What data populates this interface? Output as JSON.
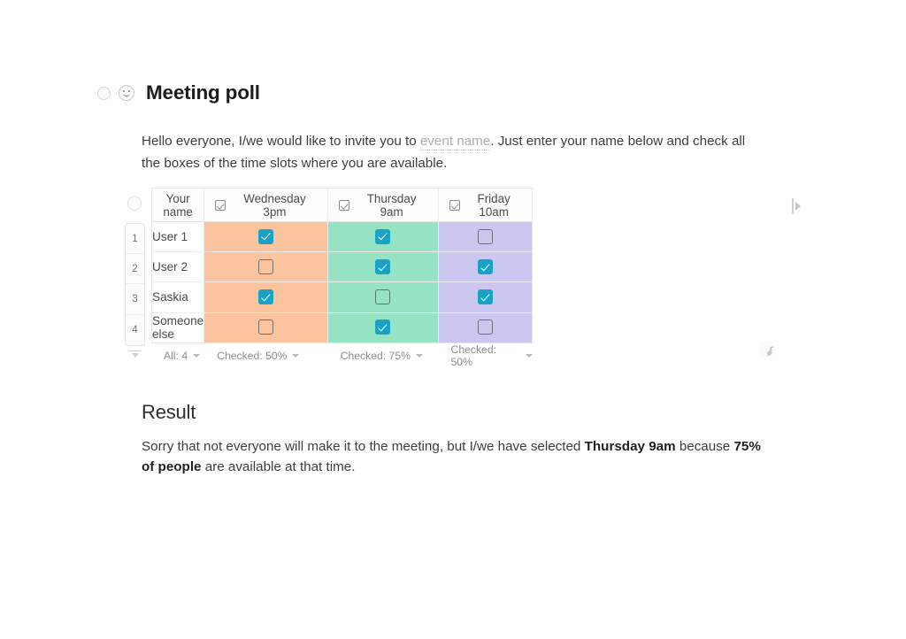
{
  "heading": {
    "bullet_icon": "circle-bullet-icon",
    "emoji_icon": "smiley-face-icon",
    "title": "Meeting poll"
  },
  "intro": {
    "before": "Hello everyone, I/we would like to invite you to ",
    "placeholder": "event name",
    "after": ". Just enter your name below and check all the boxes of the time slots where you are available."
  },
  "table": {
    "header_checkbox_icon": "checkbox-checked-icon",
    "columns": [
      {
        "key": "name",
        "label": "Your name"
      },
      {
        "key": "wed",
        "label": "Wednesday 3pm"
      },
      {
        "key": "thu",
        "label": "Thursday  9am"
      },
      {
        "key": "fri",
        "label": "Friday 10am"
      }
    ],
    "row_numbers": [
      "1",
      "2",
      "3",
      "4"
    ],
    "rows": [
      {
        "number": "1",
        "name": "User 1",
        "wed": true,
        "thu": true,
        "fri": false
      },
      {
        "number": "2",
        "name": "User 2",
        "wed": false,
        "thu": true,
        "fri": true
      },
      {
        "number": "3",
        "name": "Saskia",
        "wed": true,
        "thu": false,
        "fri": true
      },
      {
        "number": "4",
        "name": "Someone else",
        "wed": false,
        "thu": true,
        "fri": false
      }
    ],
    "footer": {
      "name": "All: 4",
      "wed": "Checked: 50%",
      "thu": "Checked: 75%",
      "fri": "Checked: 50%"
    },
    "column_colors": {
      "wed": "#FCC49E",
      "thu": "#96E3C4",
      "fri": "#CBC7F0",
      "name": "#FFFFFF"
    },
    "checkbox_checked_color": "#17A2C6",
    "handles": {
      "add_column": "add-column-handle-icon",
      "resize": "resize-grip-icon",
      "collapse_rows": "collapse-rows-icon",
      "select_all": "select-all-circle-icon"
    }
  },
  "result": {
    "title": "Result",
    "text_1": "Sorry that not everyone will make it to the meeting, but I/we have selected ",
    "bold_1": "Thursday 9am",
    "text_2": " because ",
    "bold_2": "75% of people",
    "text_3": " are available at that time."
  }
}
